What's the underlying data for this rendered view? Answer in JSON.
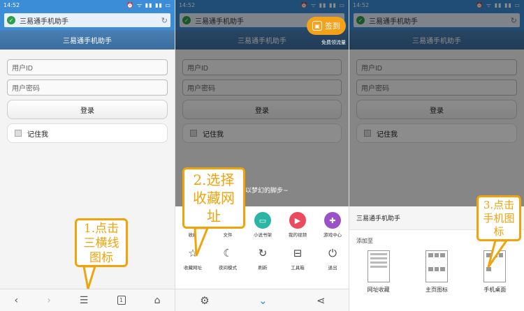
{
  "status": {
    "time": "14:52"
  },
  "browser": {
    "title": "三易通手机助手"
  },
  "app": {
    "header": "三易通手机助手"
  },
  "form": {
    "user_placeholder": "用户ID",
    "password_placeholder": "用户密码",
    "login_label": "登录",
    "remember_label": "记住我"
  },
  "nav": {
    "tab_count": "1"
  },
  "screen2": {
    "signin_label": "签到",
    "free_data": "免费领流量",
    "motto": "以梦幻的脚步~",
    "menu_row1": [
      "收藏",
      "文件",
      "小说书架",
      "我的视频",
      "游戏中心"
    ],
    "menu_row2": [
      "收藏网址",
      "夜间模式",
      "刷新",
      "工具箱",
      "退出"
    ]
  },
  "screen3": {
    "sheet_title": "三易通手机助手",
    "add_to": "添加至",
    "tiles": [
      "网址收藏",
      "主页图标",
      "手机桌面"
    ]
  },
  "callouts": {
    "step1": "1.点击\n三横线\n图标",
    "step2": "2.选择\n收藏网\n址",
    "step3": "3.点击\n手机图\n标"
  },
  "colors": {
    "status_blue": "#3a8dd6",
    "header_blue": "#4a7fb3",
    "accent_orange": "#f0a30a",
    "signin_orange": "#f4a21a"
  },
  "icons": [
    "shield-check-icon",
    "reload-icon",
    "back-icon",
    "forward-icon",
    "menu-icon",
    "tabs-icon",
    "home-icon",
    "gift-icon",
    "star-plus-icon",
    "moon-icon",
    "refresh-icon",
    "toolbox-icon",
    "power-icon",
    "settings-icon",
    "chevron-down-icon",
    "share-icon"
  ]
}
